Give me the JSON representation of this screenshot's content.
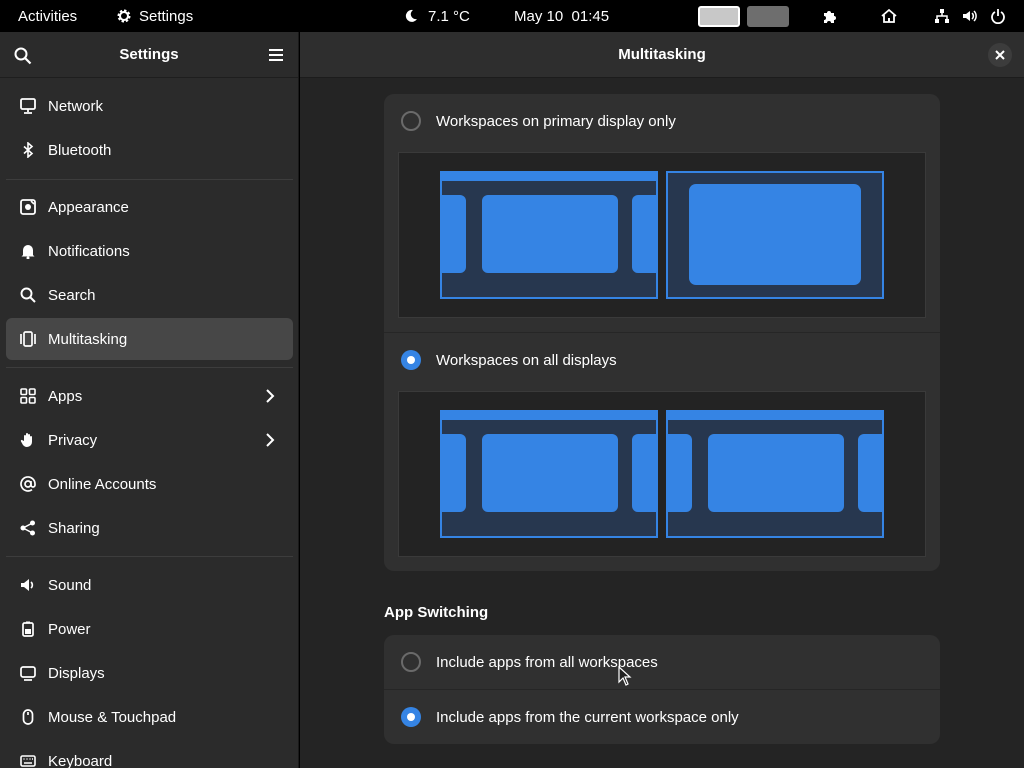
{
  "topbar": {
    "activities": "Activities",
    "app_name": "Settings",
    "weather": "7.1 °C",
    "clock": "May 10  01:45"
  },
  "sidebar": {
    "title": "Settings",
    "items": [
      {
        "label": "Network",
        "icon": "network-icon"
      },
      {
        "label": "Bluetooth",
        "icon": "bluetooth-icon"
      },
      {
        "label": "Appearance",
        "icon": "appearance-icon"
      },
      {
        "label": "Notifications",
        "icon": "bell-icon"
      },
      {
        "label": "Search",
        "icon": "search-icon"
      },
      {
        "label": "Multitasking",
        "icon": "multitasking-icon"
      },
      {
        "label": "Apps",
        "icon": "apps-icon"
      },
      {
        "label": "Privacy",
        "icon": "hand-icon"
      },
      {
        "label": "Online Accounts",
        "icon": "at-icon"
      },
      {
        "label": "Sharing",
        "icon": "share-icon"
      },
      {
        "label": "Sound",
        "icon": "speaker-icon"
      },
      {
        "label": "Power",
        "icon": "power-icon"
      },
      {
        "label": "Displays",
        "icon": "display-icon"
      },
      {
        "label": "Mouse & Touchpad",
        "icon": "mouse-icon"
      },
      {
        "label": "Keyboard",
        "icon": "keyboard-icon"
      }
    ],
    "active": "Multitasking"
  },
  "main": {
    "title": "Multitasking",
    "multi_monitor": {
      "option_primary": "Workspaces on primary display only",
      "option_all": "Workspaces on all displays",
      "selected": "option_all"
    },
    "app_switching": {
      "heading": "App Switching",
      "option_all": "Include apps from all workspaces",
      "option_current": "Include apps from the current workspace only",
      "selected": "option_current"
    }
  },
  "colors": {
    "accent": "#3584e4",
    "sidebar_bg": "#2b2b2b",
    "content_bg": "#242424",
    "card_bg": "#303030"
  }
}
